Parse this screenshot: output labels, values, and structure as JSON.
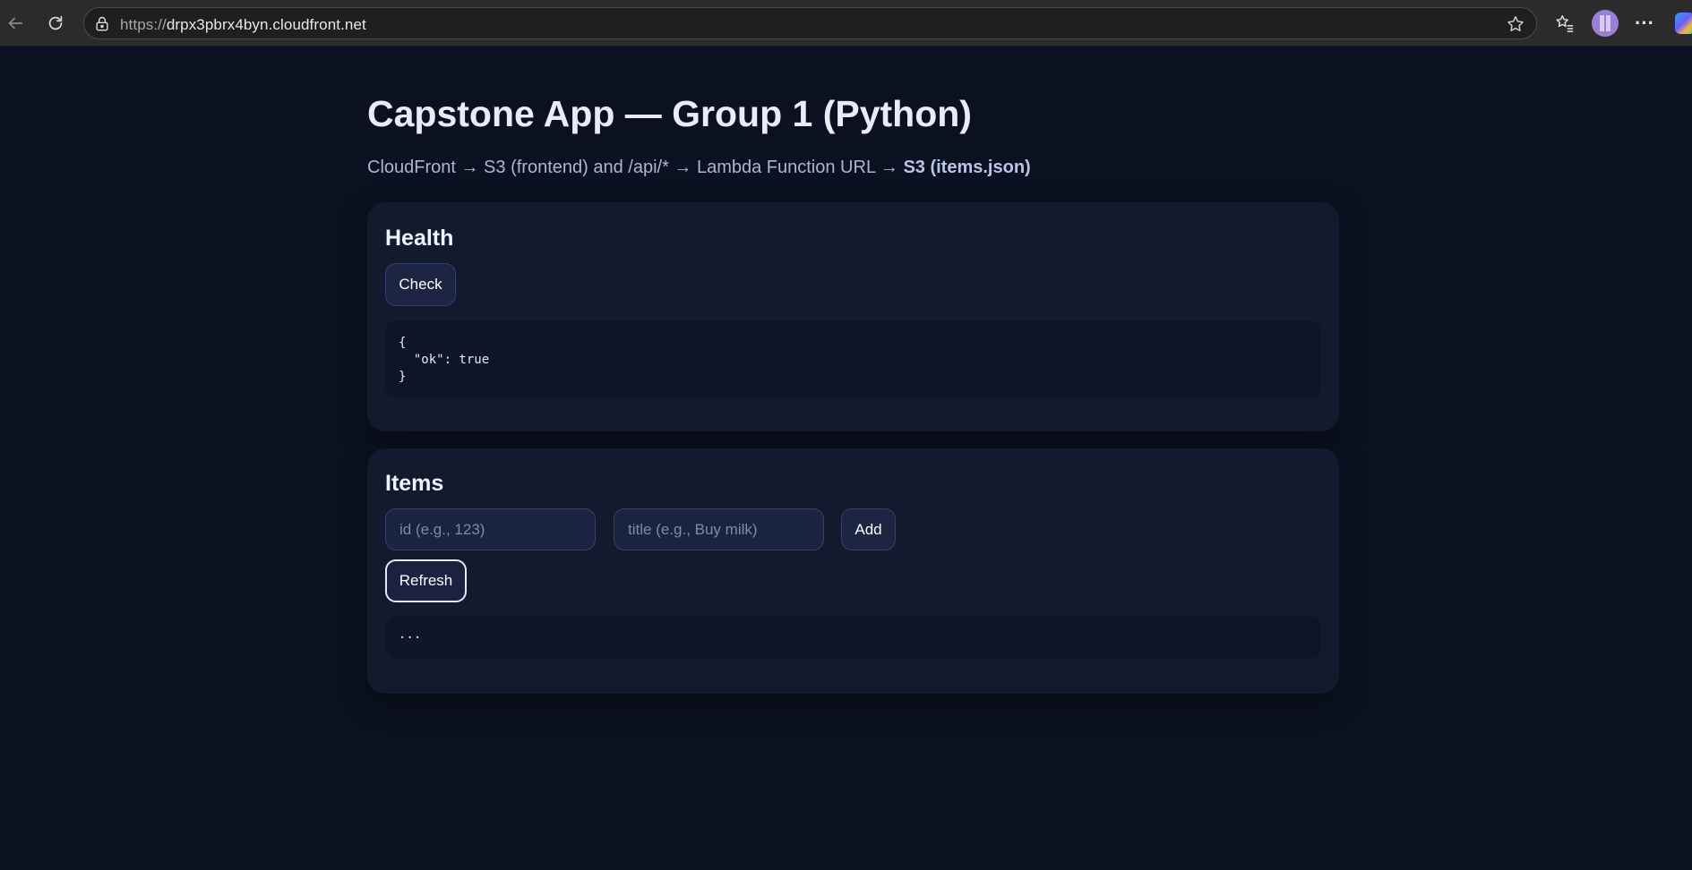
{
  "browser": {
    "url_scheme": "https://",
    "url_host": "drpx3pbrx4byn.cloudfront.net"
  },
  "page": {
    "title": "Capstone App — Group 1 (Python)",
    "subtitle_prefix": "CloudFront → S3 (frontend) and /api/* → Lambda Function URL → ",
    "subtitle_bold": "S3 (items.json)"
  },
  "health": {
    "heading": "Health",
    "check_label": "Check",
    "output": "{\n  \"ok\": true\n}"
  },
  "items": {
    "heading": "Items",
    "id_placeholder": "id (e.g., 123)",
    "title_placeholder": "title (e.g., Buy milk)",
    "add_label": "Add",
    "refresh_label": "Refresh",
    "output": "..."
  },
  "icons": {
    "back": "arrow-left-icon",
    "reload": "reload-icon",
    "lock": "site-info-icon",
    "star": "star-icon",
    "favorites": "favorites-icon",
    "more": "more-icon"
  }
}
